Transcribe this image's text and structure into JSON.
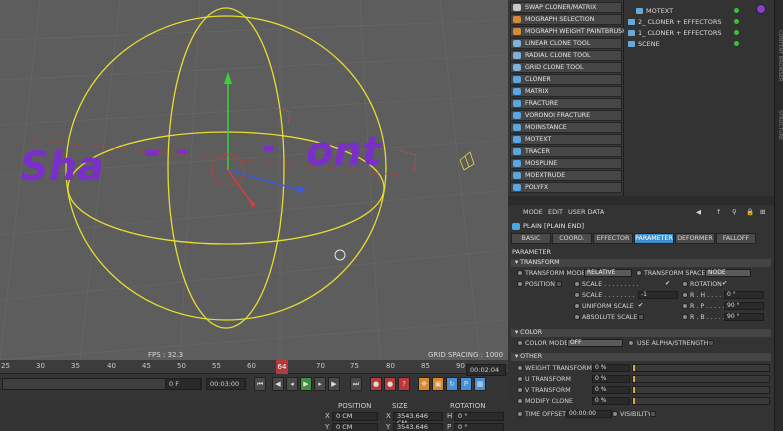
{
  "viewport": {
    "fps": "FPS : 32.3",
    "grid_spacing": "GRID SPACING : 1000 CM",
    "text_left": "Sha",
    "text_right": "ont"
  },
  "timeline": {
    "ticks": [
      "25",
      "30",
      "35",
      "40",
      "45",
      "50",
      "55",
      "60",
      "64",
      "70",
      "75",
      "80",
      "85",
      "90"
    ],
    "current_frame": "64",
    "frame_field": "0 F",
    "time_field_1": "00:03:00",
    "time_field_2": "00:02:04"
  },
  "coords": {
    "headers": {
      "position": "POSITION",
      "size": "SIZE",
      "rotation": "ROTATION"
    },
    "rows": [
      {
        "pos_axis": "X",
        "pos": "0 CM",
        "size_axis": "X",
        "size": "3543.646 CM",
        "rot_axis": "H",
        "rot": "0 °"
      },
      {
        "pos_axis": "Y",
        "pos": "0 CM",
        "size_axis": "Y",
        "size": "3543.646 CM",
        "rot_axis": "P",
        "rot": "0 °"
      }
    ]
  },
  "mograph_menu": {
    "items": [
      {
        "label": "SWAP CLONER/MATRIX",
        "color": "#c8c8c8"
      },
      {
        "label": "MOGRAPH SELECTION",
        "color": "#d48a3a"
      },
      {
        "label": "MOGRAPH WEIGHT PAINTBRUSH",
        "color": "#d48a3a"
      },
      {
        "label": "LINEAR CLONE TOOL",
        "color": "#7fb0d8"
      },
      {
        "label": "RADIAL CLONE TOOL",
        "color": "#7fb0d8"
      },
      {
        "label": "GRID CLONE TOOL",
        "color": "#7fb0d8"
      },
      {
        "label": "CLONER",
        "color": "#5aa6e0"
      },
      {
        "label": "MATRIX",
        "color": "#5aa6e0"
      },
      {
        "label": "FRACTURE",
        "color": "#5aa6e0"
      },
      {
        "label": "VORONOI FRACTURE",
        "color": "#5aa6e0"
      },
      {
        "label": "MOINSTANCE",
        "color": "#5aa6e0"
      },
      {
        "label": "MOTEXT",
        "color": "#5aa6e0"
      },
      {
        "label": "TRACER",
        "color": "#5aa6e0"
      },
      {
        "label": "MOSPLINE",
        "color": "#5aa6e0"
      },
      {
        "label": "MOEXTRUDE",
        "color": "#5aa6e0"
      },
      {
        "label": "POLYFX",
        "color": "#5aa6e0"
      }
    ]
  },
  "objects": {
    "rows": [
      {
        "label": "MOTEXT",
        "indent": 12
      },
      {
        "label": "2_ CLONER + EFFECTORS",
        "indent": 4
      },
      {
        "label": "1_ CLONER + EFFECTORS",
        "indent": 4
      },
      {
        "label": "SCENE",
        "indent": 4
      }
    ],
    "side_tabs": [
      "CONTENT BROWSER",
      "STRUCTURE"
    ]
  },
  "attributes": {
    "menu": [
      "MODE",
      "EDIT",
      "USER DATA"
    ],
    "object_title": "PLAIN [PLAIN END]",
    "tabs": [
      "BASIC",
      "COORD.",
      "EFFECTOR",
      "PARAMETER",
      "DEFORMER",
      "FALLOFF"
    ],
    "active_tab": "PARAMETER",
    "section_parameter": "PARAMETER",
    "transform": {
      "title": "TRANSFORM",
      "transform_mode_label": "TRANSFORM MODE",
      "transform_mode_value": "RELATIVE",
      "transform_space_label": "TRANSFORM SPACE",
      "transform_space_value": "NODE",
      "position_label": "POSITION",
      "scale_check_label": "SCALE . . . . . . . . .",
      "scale_check_mark": "✔",
      "rotation_label": "ROTATION",
      "rotation_mark": "✔",
      "scale_label": "SCALE . . . . . . . .",
      "scale_value": "-1",
      "uniform_scale_label": "UNIFORM SCALE",
      "uniform_scale_mark": "✔",
      "absolute_scale_label": "ABSOLUTE SCALE",
      "rh_label": "R . H . . . . . . .",
      "rh_value": "0 °",
      "rp_label": "R . P . . . . . . .",
      "rp_value": "90 °",
      "rb_label": "R . B . . . . . . .",
      "rb_value": "90 °"
    },
    "color": {
      "title": "COLOR",
      "color_mode_label": "COLOR MODE",
      "color_mode_value": "OFF",
      "use_alpha_label": "USE ALPHA/STRENGTH"
    },
    "other": {
      "title": "OTHER",
      "rows": [
        {
          "label": "WEIGHT TRANSFORM",
          "value": "0 %"
        },
        {
          "label": "U TRANSFORM",
          "value": "0 %"
        },
        {
          "label": "V TRANSFORM",
          "value": "0 %"
        },
        {
          "label": "MODIFY CLONE",
          "value": "0 %"
        }
      ],
      "time_offset_label": "TIME OFFSET",
      "time_offset_value": "00:00:00",
      "visibility_label": "VISIBILITY"
    }
  },
  "colors": {
    "accent": "#3d8fce",
    "gizmo": "#e6dc32",
    "text_purple": "#7a2fc8"
  }
}
